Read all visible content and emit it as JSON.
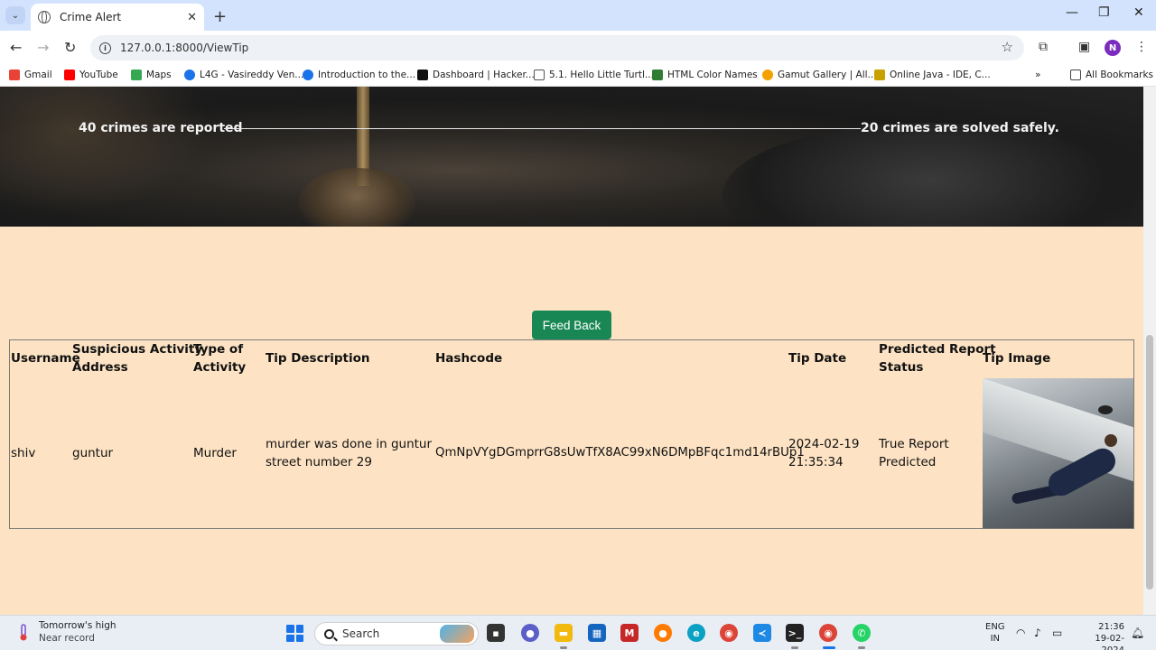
{
  "browser": {
    "tab_title": "Crime Alert",
    "url": "127.0.0.1:8000/ViewTip",
    "profile_initial": "N",
    "bookmarks": [
      {
        "label": "Gmail",
        "color": "#ea4335"
      },
      {
        "label": "YouTube",
        "color": "#ff0000"
      },
      {
        "label": "Maps",
        "color": "#34a853"
      },
      {
        "label": "L4G - Vasireddy Ven...",
        "color": "#1a73e8"
      },
      {
        "label": "Introduction to the...",
        "color": "#1a73e8"
      },
      {
        "label": "Dashboard | Hacker...",
        "color": "#111111"
      },
      {
        "label": "5.1. Hello Little Turtl...",
        "color": "#555555"
      },
      {
        "label": "HTML Color Names",
        "color": "#2e7d32"
      },
      {
        "label": "Gamut Gallery | All...",
        "color": "#f4a000"
      },
      {
        "label": "Online Java - IDE, C...",
        "color": "#c8a000"
      }
    ],
    "all_bookmarks_label": "All Bookmarks"
  },
  "hero": {
    "reported_text": "40  crimes are reported",
    "solved_text": "20 crimes are solved safely."
  },
  "feedback_button": "Feed Back",
  "table": {
    "headers": {
      "username": "Username",
      "address_line1": "Suspicious Activity",
      "address_line2": "Address",
      "type_line1": "Type of",
      "type_line2": "Activity",
      "description": "Tip Description",
      "hashcode": "Hashcode",
      "date": "Tip Date",
      "status_line1": "Predicted Report",
      "status_line2": "Status",
      "image": "Tip Image"
    },
    "row": {
      "username": "shiv",
      "address": "guntur",
      "type": "Murder",
      "description_line1": "murder was done in guntur",
      "description_line2": "street number 29",
      "hashcode": "QmNpVYgDGmprrG8sUwTfX8AC99xN6DMpBFqc1md14rBUp1",
      "date_line1": "2024-02-19",
      "date_line2": "21:35:34",
      "status_line1": "True Report",
      "status_line2": "Predicted"
    }
  },
  "taskbar": {
    "weather_line1": "Tomorrow's high",
    "weather_line2": "Near record",
    "search_placeholder": "Search",
    "lang_line1": "ENG",
    "lang_line2": "IN",
    "time": "21:36",
    "date": "19-02-2024"
  },
  "colors": {
    "page_background": "#fde3c4",
    "feedback_button": "#198754",
    "tabbar": "#d3e3fd"
  }
}
